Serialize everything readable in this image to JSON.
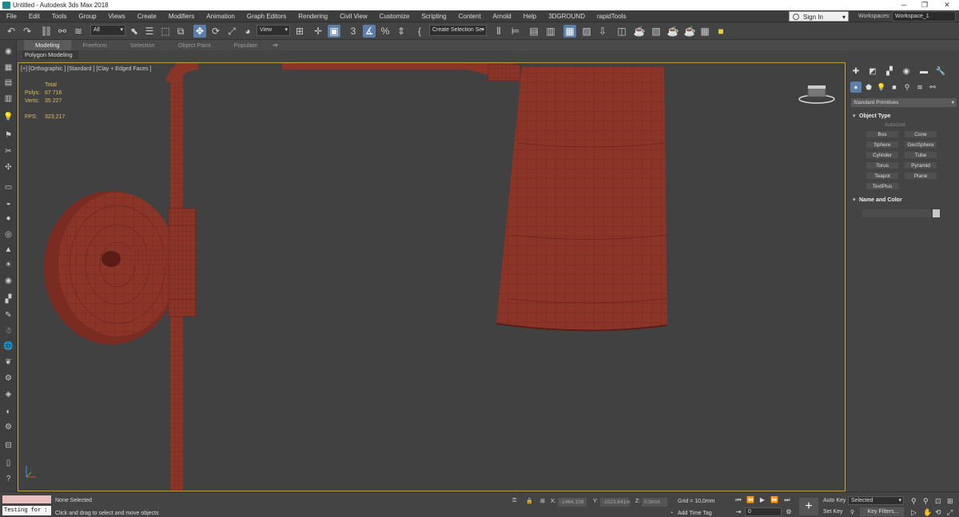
{
  "window": {
    "title": "Untitled - Autodesk 3ds Max 2018"
  },
  "menu": [
    "File",
    "Edit",
    "Tools",
    "Group",
    "Views",
    "Create",
    "Modifiers",
    "Animation",
    "Graph Editors",
    "Rendering",
    "Civil View",
    "Customize",
    "Scripting",
    "Content",
    "Arnold",
    "Help",
    "3DGROUND",
    "rapidTools"
  ],
  "account": {
    "sign_in": "Sign In",
    "workspaces_label": "Workspaces:",
    "workspace": "Workspace_1"
  },
  "toolbar": {
    "filter": "All",
    "ref_coord": "View",
    "selection_set": "Create Selection Se"
  },
  "ribbon": {
    "tabs": [
      "Modeling",
      "Freeform",
      "Selection",
      "Object Paint",
      "Populate"
    ],
    "active": "Modeling",
    "sub": "Polygon Modeling"
  },
  "viewport": {
    "label": "[+] [Orthographic ] [Standard ] [Clay + Edged Faces ]",
    "stats": {
      "total_label": "Total",
      "polys_label": "Polys:",
      "polys": "67 716",
      "verts_label": "Verts:",
      "verts": "35 227",
      "fps_label": "FPS:",
      "fps": "323,217"
    }
  },
  "command_panel": {
    "category": "Standard Primitives",
    "object_type_title": "Object Type",
    "autogrid": "AutoGrid",
    "primitives": [
      "Box",
      "Cone",
      "Sphere",
      "GeoSphere",
      "Cylinder",
      "Tube",
      "Torus",
      "Pyramid",
      "Teapot",
      "Plane",
      "TextPlus"
    ],
    "name_color_title": "Name and Color"
  },
  "status": {
    "maxscript_input": "Testing for :",
    "selection": "None Selected",
    "prompt": "Click and drag to select and move objects",
    "x_label": "X:",
    "x": "-1464,108",
    "y_label": "Y:",
    "y": "-1023,641m",
    "z_label": "Z:",
    "z": "0,0mm",
    "grid": "Grid = 10,0mm",
    "add_time_tag": "Add Time Tag",
    "frame": "0",
    "auto_key": "Auto Key",
    "set_key": "Set Key",
    "key_mode": "Selected",
    "key_filters": "Key Filters..."
  },
  "colors": {
    "model": "#8b3529",
    "viewport_bg": "#414141",
    "active_border": "#bfa045"
  }
}
